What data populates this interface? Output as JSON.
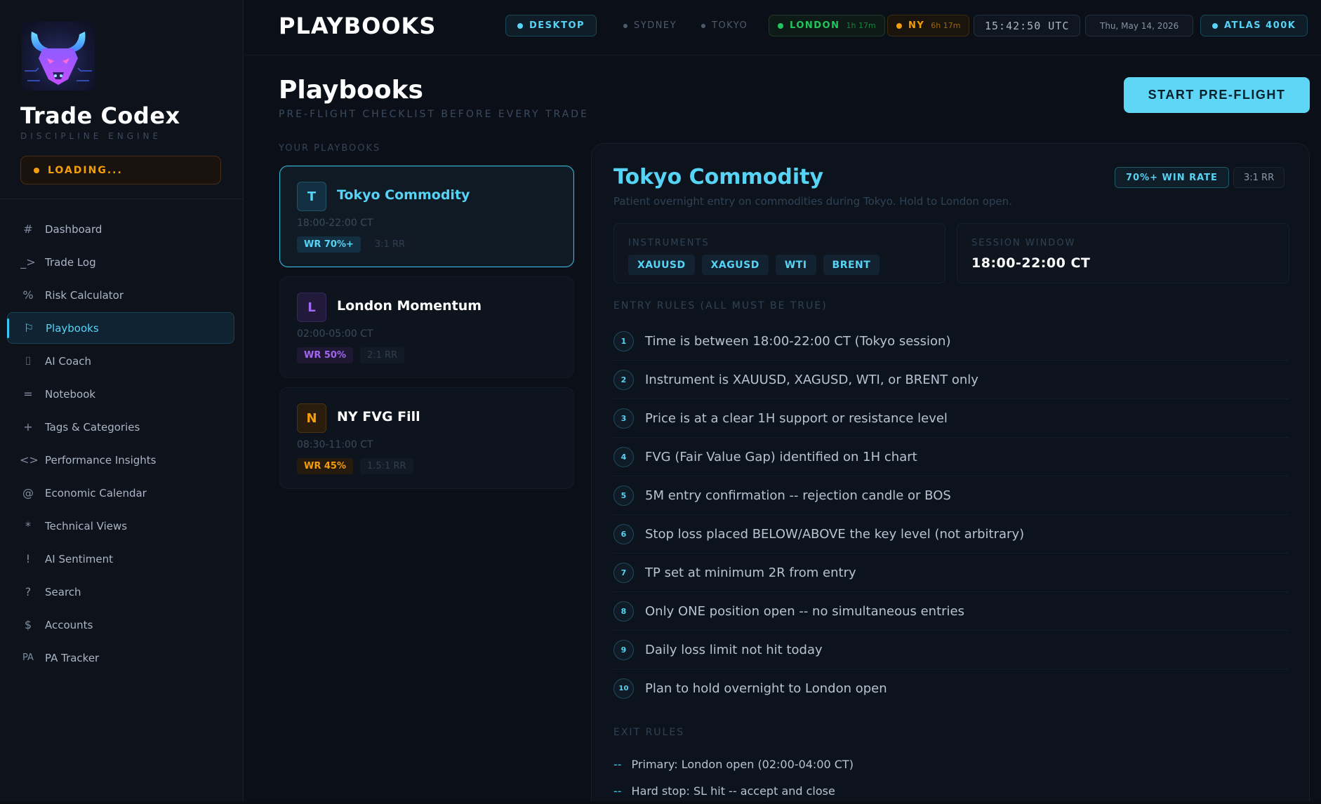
{
  "brand": {
    "title": "Trade Codex",
    "subtitle": "DISCIPLINE ENGINE",
    "status": "LOADING..."
  },
  "nav": [
    {
      "icon": "#",
      "label": "Dashboard"
    },
    {
      "icon": "_>",
      "label": "Trade Log"
    },
    {
      "icon": "%",
      "label": "Risk Calculator"
    },
    {
      "icon": "⚐",
      "label": "Playbooks"
    },
    {
      "icon": "⌷",
      "label": "AI Coach"
    },
    {
      "icon": "=",
      "label": "Notebook"
    },
    {
      "icon": "+",
      "label": "Tags & Categories"
    },
    {
      "icon": "<>",
      "label": "Performance Insights"
    },
    {
      "icon": "@",
      "label": "Economic Calendar"
    },
    {
      "icon": "*",
      "label": "Technical Views"
    },
    {
      "icon": "!",
      "label": "AI Sentiment"
    },
    {
      "icon": "?",
      "label": "Search"
    },
    {
      "icon": "$",
      "label": "Accounts"
    },
    {
      "icon": "PA",
      "label": "PA Tracker"
    }
  ],
  "header": {
    "title": "PLAYBOOKS",
    "mode": "DESKTOP",
    "sessions": [
      {
        "name": "SYDNEY",
        "time": ""
      },
      {
        "name": "TOKYO",
        "time": ""
      },
      {
        "name": "LONDON",
        "time": "1h 17m"
      },
      {
        "name": "NY",
        "time": "6h 17m"
      }
    ],
    "clock": "15:42:50 UTC",
    "date": "Thu, May 14, 2026",
    "account": "ATLAS 400K"
  },
  "page": {
    "title": "Playbooks",
    "subtitle": "PRE-FLIGHT CHECKLIST BEFORE EVERY TRADE",
    "cta": "START PRE-FLIGHT",
    "list_label": "YOUR PLAYBOOKS"
  },
  "colors": {
    "accent": "#56d3f5",
    "purple": "#a266f0",
    "orange": "#f59e0b",
    "green": "#22c55e"
  },
  "playbooks": [
    {
      "letter": "T",
      "name": "Tokyo Commodity",
      "time": "18:00-22:00 CT",
      "wr": "WR 70%+",
      "rr": "3:1 RR"
    },
    {
      "letter": "L",
      "name": "London Momentum",
      "time": "02:00-05:00 CT",
      "wr": "WR 50%",
      "rr": "2:1 RR"
    },
    {
      "letter": "N",
      "name": "NY FVG Fill",
      "time": "08:30-11:00 CT",
      "wr": "WR 45%",
      "rr": "1.5:1 RR"
    }
  ],
  "detail": {
    "title": "Tokyo Commodity",
    "description": "Patient overnight entry on commodities during Tokyo. Hold to London open.",
    "win_rate": "70%+ WIN RATE",
    "rr": "3:1 RR",
    "instruments_label": "INSTRUMENTS",
    "instruments": [
      "XAUUSD",
      "XAGUSD",
      "WTI",
      "BRENT"
    ],
    "session_label": "SESSION WINDOW",
    "session_value": "18:00-22:00 CT",
    "entry_label": "ENTRY RULES (ALL MUST BE TRUE)",
    "entry_rules": [
      {
        "n": "1",
        "text": "Time is between 18:00-22:00 CT (Tokyo session)"
      },
      {
        "n": "2",
        "text": "Instrument is XAUUSD, XAGUSD, WTI, or BRENT only"
      },
      {
        "n": "3",
        "text": "Price is at a clear 1H support or resistance level"
      },
      {
        "n": "4",
        "text": "FVG (Fair Value Gap) identified on 1H chart"
      },
      {
        "n": "5",
        "text": "5M entry confirmation -- rejection candle or BOS"
      },
      {
        "n": "6",
        "text": "Stop loss placed BELOW/ABOVE the key level (not arbitrary)"
      },
      {
        "n": "7",
        "text": "TP set at minimum 2R from entry"
      },
      {
        "n": "8",
        "text": "Only ONE position open -- no simultaneous entries"
      },
      {
        "n": "9",
        "text": "Daily loss limit not hit today"
      },
      {
        "n": "10",
        "text": "Plan to hold overnight to London open"
      }
    ],
    "exit_label": "EXIT RULES",
    "exit_rules": [
      "Primary: London open (02:00-04:00 CT)",
      "Hard stop: SL hit -- accept and close"
    ]
  }
}
